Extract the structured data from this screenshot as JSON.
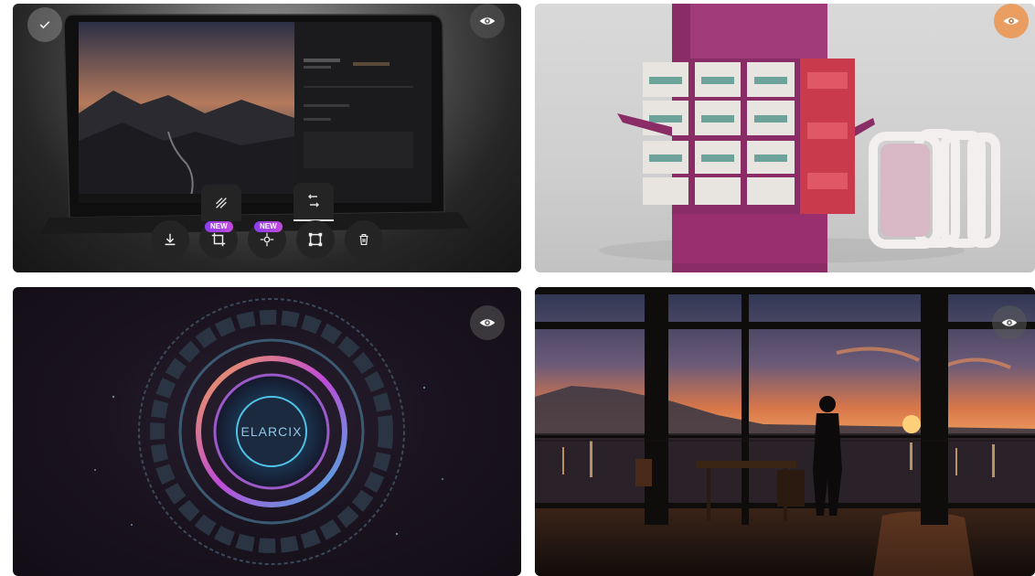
{
  "gallery": {
    "tiles": [
      {
        "name": "laptop-editor-image"
      },
      {
        "name": "pink-machine-image"
      },
      {
        "name": "sci-fi-emblem-image",
        "emblem_text": "ELARCIX"
      },
      {
        "name": "sunset-window-image"
      }
    ]
  },
  "toolbar": {
    "badges": {
      "new_1": "NEW",
      "new_2": "NEW"
    },
    "icons": [
      "download-icon",
      "crop-icon",
      "sparkle-icon",
      "resize-icon",
      "trash-icon",
      "pattern-icon",
      "swap-icon"
    ]
  },
  "colors": {
    "badge": "#9b3fe8",
    "button_bg": "#242424",
    "accent_orange": "#f08a3a"
  }
}
